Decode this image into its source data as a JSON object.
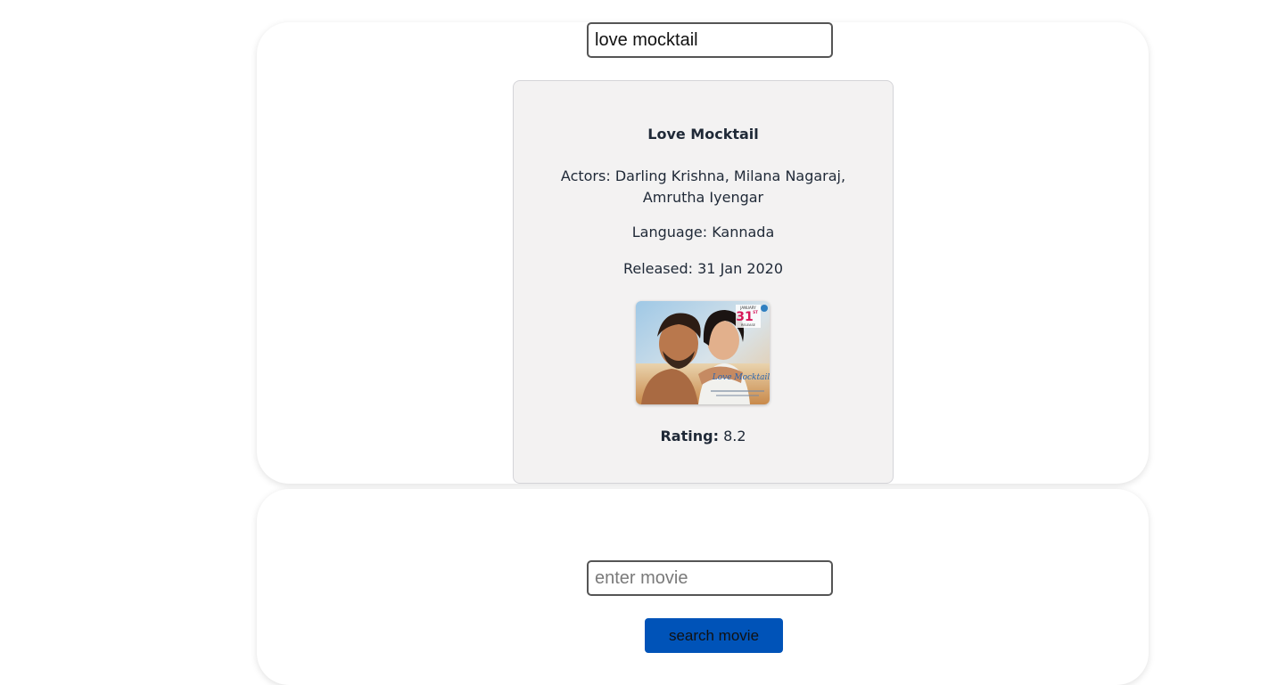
{
  "search": {
    "query_value": "love mocktail",
    "movie_placeholder": "enter movie",
    "movie_value": "",
    "button_label": "search movie"
  },
  "movie": {
    "title": "Love Mocktail",
    "actors": "Actors: Darling Krishna, Milana Nagaraj, Amrutha Iyengar",
    "language": "Language: Kannada",
    "released": "Released: 31 Jan 2020",
    "rating_label": "Rating:",
    "rating_value": "8.2",
    "poster_text": {
      "release_month": "JANUARY",
      "release_day": "31",
      "release_day_suffix": "ST",
      "release_word": "RELEASE",
      "logo": "Love Mocktail"
    }
  },
  "colors": {
    "button_bg": "#0053b8",
    "card_bg": "#f3f2f2",
    "text": "#1f2937"
  }
}
